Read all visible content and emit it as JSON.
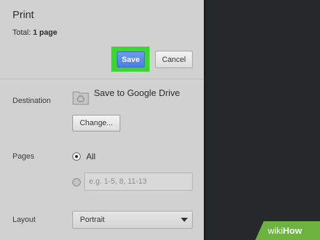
{
  "dialog": {
    "title": "Print",
    "total_label": "Total:",
    "total_value": "1 page",
    "save_label": "Save",
    "cancel_label": "Cancel"
  },
  "destination": {
    "label": "Destination",
    "icon": "google-drive-icon",
    "name": "Save to Google Drive",
    "change_label": "Change..."
  },
  "pages": {
    "label": "Pages",
    "all_label": "All",
    "all_selected": true,
    "custom_placeholder": "e.g. 1-5, 8, 11-13",
    "custom_value": ""
  },
  "layout": {
    "label": "Layout",
    "selected": "Portrait"
  },
  "watermark": {
    "wiki": "wiki",
    "how": "How"
  },
  "colors": {
    "panel_bg": "#d1d1d1",
    "page_bg": "#25292b",
    "save_button": "#4a7ee6",
    "save_highlight": "#3ed436",
    "watermark_green": "#6cb23e"
  }
}
